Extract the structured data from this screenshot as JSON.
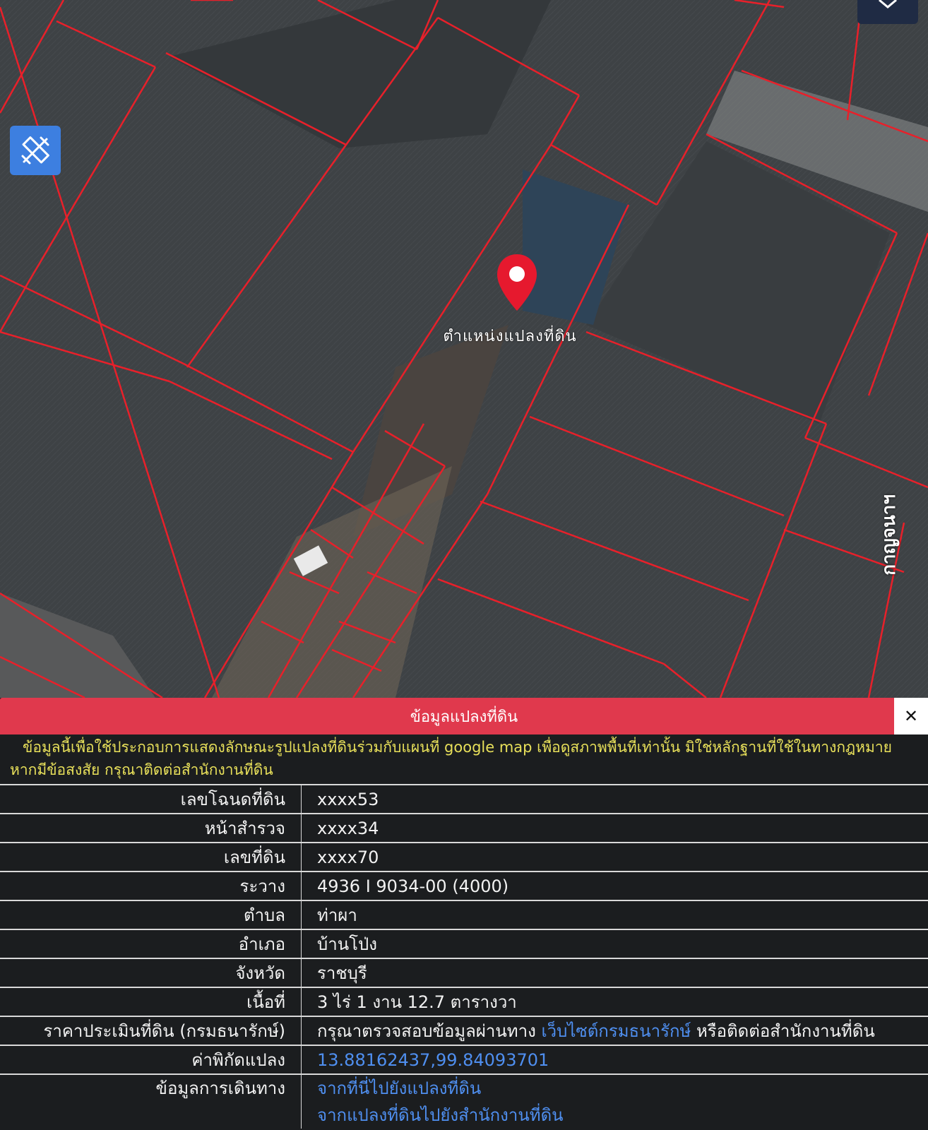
{
  "map": {
    "pin_label": "ตำแหน่งแปลงที่ดิน",
    "road_label": "กาญจนาฯ",
    "colors": {
      "parcel_line": "#e8202a",
      "pin": "#e6192e",
      "tool_button": "#3d7fe0"
    },
    "icons": {
      "tool": "ruler-pencil-icon",
      "layers": "chevron-down-icon",
      "pin": "map-pin-icon"
    }
  },
  "panel": {
    "title": "ข้อมูลแปลงที่ดิน",
    "close_label": "✕",
    "disclaimer_line1": "ข้อมูลนี้เพื่อใช้ประกอบการแสดงลักษณะรูปแปลงที่ดินร่วมกับแผนที่ google map เพื่อดูสภาพพื้นที่เท่านั้น มิใช่หลักฐานที่ใช้ในทางกฎหมาย",
    "disclaimer_line2": "หากมีข้อสงสัย กรุณาติดต่อสำนักงานที่ดิน",
    "rows": [
      {
        "key": "เลขโฉนดที่ดิน",
        "value": "xxxx53"
      },
      {
        "key": "หน้าสำรวจ",
        "value": "xxxx34"
      },
      {
        "key": "เลขที่ดิน",
        "value": "xxxx70"
      },
      {
        "key": "ระวาง",
        "value": "4936 I 9034-00 (4000)"
      },
      {
        "key": "ตำบล",
        "value": "ท่าผา"
      },
      {
        "key": "อำเภอ",
        "value": "บ้านโป่ง"
      },
      {
        "key": "จังหวัด",
        "value": "ราชบุรี"
      },
      {
        "key": "เนื้อที่",
        "value": "3 ไร่ 1 งาน 12.7 ตารางวา"
      }
    ],
    "price": {
      "key": "ราคาประเมินที่ดิน (กรมธนารักษ์)",
      "prefix": "กรุณาตรวจสอบข้อมูลผ่านทาง",
      "link": "เว็บไซต์กรมธนารักษ์",
      "suffix": "หรือติดต่อสำนักงานที่ดิน"
    },
    "coords": {
      "key": "ค่าพิกัดแปลง",
      "value": "13.88162437,99.84093701"
    },
    "travel": {
      "key": "ข้อมูลการเดินทาง",
      "link1": "จากที่นี่ไปยังแปลงที่ดิน",
      "link2": "จากแปลงที่ดินไปยังสำนักงานที่ดิน"
    }
  }
}
